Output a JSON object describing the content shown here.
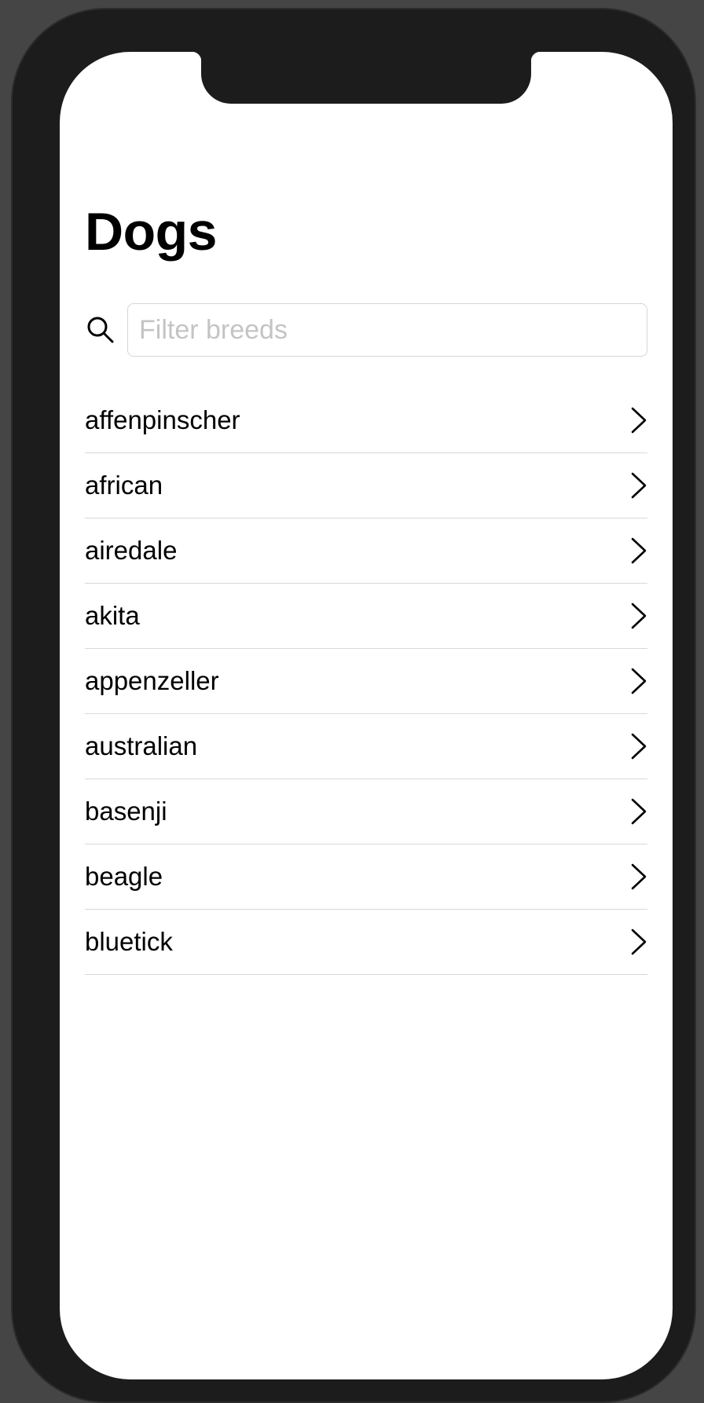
{
  "header": {
    "title": "Dogs"
  },
  "search": {
    "icon": "search-icon",
    "placeholder": "Filter breeds",
    "value": ""
  },
  "breeds": {
    "items": [
      {
        "label": "affenpinscher",
        "icon": "chevron-right-icon"
      },
      {
        "label": "african",
        "icon": "chevron-right-icon"
      },
      {
        "label": "airedale",
        "icon": "chevron-right-icon"
      },
      {
        "label": "akita",
        "icon": "chevron-right-icon"
      },
      {
        "label": "appenzeller",
        "icon": "chevron-right-icon"
      },
      {
        "label": "australian",
        "icon": "chevron-right-icon"
      },
      {
        "label": "basenji",
        "icon": "chevron-right-icon"
      },
      {
        "label": "beagle",
        "icon": "chevron-right-icon"
      },
      {
        "label": "bluetick",
        "icon": "chevron-right-icon"
      }
    ]
  },
  "colors": {
    "background": "#ffffff",
    "text": "#000000",
    "placeholder": "#c4c4c6",
    "separator": "#d9d9d9",
    "device_frame": "#1c1c1c"
  }
}
